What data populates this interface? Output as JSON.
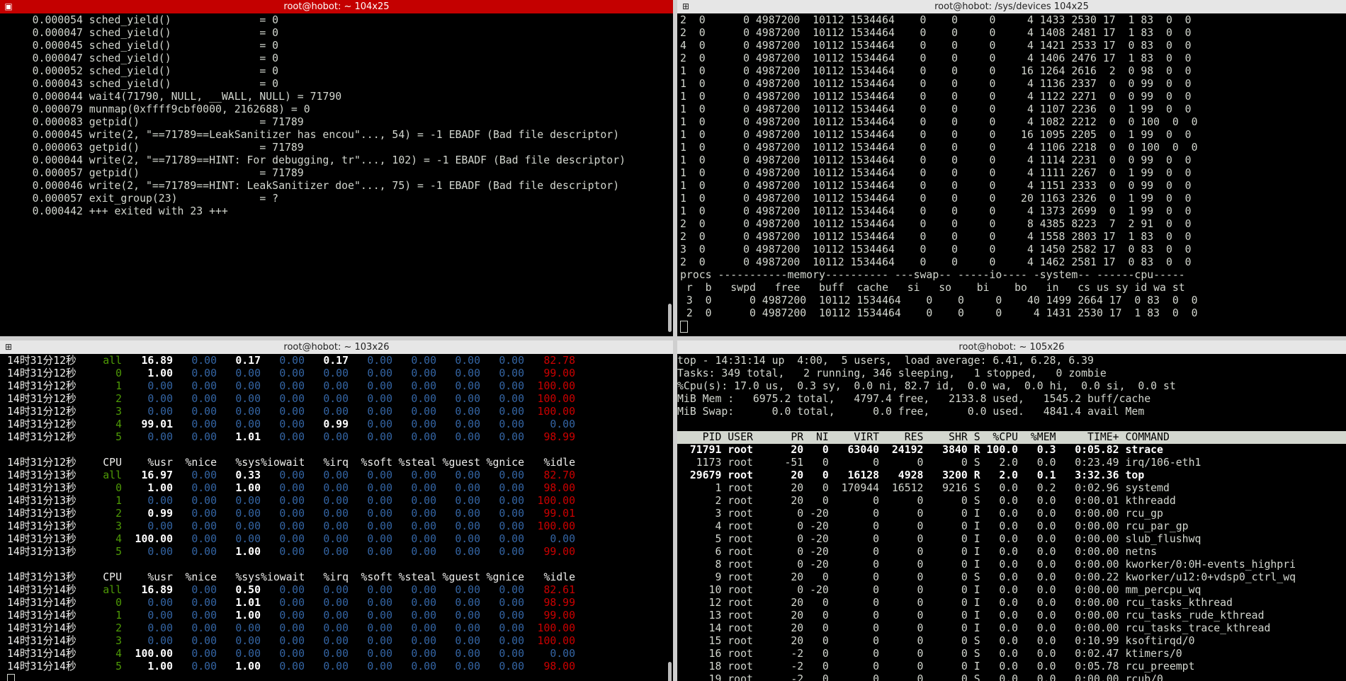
{
  "panes": {
    "tl": {
      "title": "root@hobot: ~ 104x25",
      "lines": [
        "    0.000054 sched_yield()              = 0",
        "    0.000047 sched_yield()              = 0",
        "    0.000045 sched_yield()              = 0",
        "    0.000047 sched_yield()              = 0",
        "    0.000052 sched_yield()              = 0",
        "    0.000043 sched_yield()              = 0",
        "    0.000044 wait4(71790, NULL, __WALL, NULL) = 71790",
        "    0.000079 munmap(0xffff9cbf0000, 2162688) = 0",
        "    0.000083 getpid()                   = 71789",
        "    0.000045 write(2, \"==71789==LeakSanitizer has encou\"..., 54) = -1 EBADF (Bad file descriptor)",
        "    0.000063 getpid()                   = 71789",
        "    0.000044 write(2, \"==71789==HINT: For debugging, tr\"..., 102) = -1 EBADF (Bad file descriptor)",
        "    0.000057 getpid()                   = 71789",
        "    0.000046 write(2, \"==71789==HINT: LeakSanitizer doe\"..., 75) = -1 EBADF (Bad file descriptor)",
        "    0.000057 exit_group(23)             = ?",
        "    0.000442 +++ exited with 23 +++"
      ]
    },
    "tr": {
      "title": "root@hobot: /sys/devices 104x25",
      "lines": [
        "2  0      0 4987200  10112 1534464    0    0     0     4 1433 2530 17  1 83  0  0",
        "2  0      0 4987200  10112 1534464    0    0     0     4 1408 2481 17  1 83  0  0",
        "4  0      0 4987200  10112 1534464    0    0     0     4 1421 2533 17  0 83  0  0",
        "2  0      0 4987200  10112 1534464    0    0     0     4 1406 2476 17  1 83  0  0",
        "1  0      0 4987200  10112 1534464    0    0     0    16 1264 2616  2  0 98  0  0",
        "1  0      0 4987200  10112 1534464    0    0     0     4 1136 2337  0  0 99  0  0",
        "1  0      0 4987200  10112 1534464    0    0     0     4 1122 2271  0  0 99  0  0",
        "1  0      0 4987200  10112 1534464    0    0     0     4 1107 2236  0  1 99  0  0",
        "1  0      0 4987200  10112 1534464    0    0     0     4 1082 2212  0  0 100  0  0",
        "1  0      0 4987200  10112 1534464    0    0     0    16 1095 2205  0  1 99  0  0",
        "1  0      0 4987200  10112 1534464    0    0     0     4 1106 2218  0  0 100  0  0",
        "1  0      0 4987200  10112 1534464    0    0     0     4 1114 2231  0  0 99  0  0",
        "1  0      0 4987200  10112 1534464    0    0     0     4 1111 2267  0  1 99  0  0",
        "1  0      0 4987200  10112 1534464    0    0     0     4 1151 2333  0  0 99  0  0",
        "1  0      0 4987200  10112 1534464    0    0     0    20 1163 2326  0  1 99  0  0",
        "1  0      0 4987200  10112 1534464    0    0     0     4 1373 2699  0  1 99  0  0",
        "2  0      0 4987200  10112 1534464    0    0     0     8 4385 8223  7  2 91  0  0",
        "2  0      0 4987200  10112 1534464    0    0     0     4 1558 2803 17  1 83  0  0",
        "3  0      0 4987200  10112 1534464    0    0     0     4 1450 2582 17  0 83  0  0",
        "2  0      0 4987200  10112 1534464    0    0     0     4 1462 2581 17  0 83  0  0",
        "procs -----------memory---------- ---swap-- -----io---- -system-- ------cpu-----",
        " r  b   swpd   free   buff  cache   si   so    bi    bo   in   cs us sy id wa st",
        " 3  0      0 4987200  10112 1534464    0    0     0    40 1499 2664 17  0 83  0  0",
        " 2  0      0 4987200  10112 1534464    0    0     0     4 1431 2530 17  1 83  0  0"
      ]
    },
    "bl": {
      "title": "root@hobot: ~ 103x26",
      "blocks": [
        {
          "rows": [
            [
              "14时31分12秒",
              "all",
              "16.89",
              "0.00",
              "0.17",
              "0.00",
              "0.17",
              "0.00",
              "0.00",
              "0.00",
              "0.00",
              "82.78"
            ],
            [
              "14时31分12秒",
              "0",
              "1.00",
              "0.00",
              "0.00",
              "0.00",
              "0.00",
              "0.00",
              "0.00",
              "0.00",
              "0.00",
              "99.00"
            ],
            [
              "14时31分12秒",
              "1",
              "0.00",
              "0.00",
              "0.00",
              "0.00",
              "0.00",
              "0.00",
              "0.00",
              "0.00",
              "0.00",
              "100.00"
            ],
            [
              "14时31分12秒",
              "2",
              "0.00",
              "0.00",
              "0.00",
              "0.00",
              "0.00",
              "0.00",
              "0.00",
              "0.00",
              "0.00",
              "100.00"
            ],
            [
              "14时31分12秒",
              "3",
              "0.00",
              "0.00",
              "0.00",
              "0.00",
              "0.00",
              "0.00",
              "0.00",
              "0.00",
              "0.00",
              "100.00"
            ],
            [
              "14时31分12秒",
              "4",
              "99.01",
              "0.00",
              "0.00",
              "0.00",
              "0.99",
              "0.00",
              "0.00",
              "0.00",
              "0.00",
              "0.00"
            ],
            [
              "14时31分12秒",
              "5",
              "0.00",
              "0.00",
              "1.01",
              "0.00",
              "0.00",
              "0.00",
              "0.00",
              "0.00",
              "0.00",
              "98.99"
            ]
          ]
        },
        {
          "header": [
            "14时31分12秒",
            "CPU",
            "%usr",
            "%nice",
            "%sys",
            "%iowait",
            "%irq",
            "%soft",
            "%steal",
            "%guest",
            "%gnice",
            "%idle"
          ],
          "rows": [
            [
              "14时31分13秒",
              "all",
              "16.97",
              "0.00",
              "0.33",
              "0.00",
              "0.00",
              "0.00",
              "0.00",
              "0.00",
              "0.00",
              "82.70"
            ],
            [
              "14时31分13秒",
              "0",
              "1.00",
              "0.00",
              "1.00",
              "0.00",
              "0.00",
              "0.00",
              "0.00",
              "0.00",
              "0.00",
              "98.00"
            ],
            [
              "14时31分13秒",
              "1",
              "0.00",
              "0.00",
              "0.00",
              "0.00",
              "0.00",
              "0.00",
              "0.00",
              "0.00",
              "0.00",
              "100.00"
            ],
            [
              "14时31分13秒",
              "2",
              "0.99",
              "0.00",
              "0.00",
              "0.00",
              "0.00",
              "0.00",
              "0.00",
              "0.00",
              "0.00",
              "99.01"
            ],
            [
              "14时31分13秒",
              "3",
              "0.00",
              "0.00",
              "0.00",
              "0.00",
              "0.00",
              "0.00",
              "0.00",
              "0.00",
              "0.00",
              "100.00"
            ],
            [
              "14时31分13秒",
              "4",
              "100.00",
              "0.00",
              "0.00",
              "0.00",
              "0.00",
              "0.00",
              "0.00",
              "0.00",
              "0.00",
              "0.00"
            ],
            [
              "14时31分13秒",
              "5",
              "0.00",
              "0.00",
              "1.00",
              "0.00",
              "0.00",
              "0.00",
              "0.00",
              "0.00",
              "0.00",
              "99.00"
            ]
          ]
        },
        {
          "header": [
            "14时31分13秒",
            "CPU",
            "%usr",
            "%nice",
            "%sys",
            "%iowait",
            "%irq",
            "%soft",
            "%steal",
            "%guest",
            "%gnice",
            "%idle"
          ],
          "rows": [
            [
              "14时31分14秒",
              "all",
              "16.89",
              "0.00",
              "0.50",
              "0.00",
              "0.00",
              "0.00",
              "0.00",
              "0.00",
              "0.00",
              "82.61"
            ],
            [
              "14时31分14秒",
              "0",
              "0.00",
              "0.00",
              "1.01",
              "0.00",
              "0.00",
              "0.00",
              "0.00",
              "0.00",
              "0.00",
              "98.99"
            ],
            [
              "14时31分14秒",
              "1",
              "0.00",
              "0.00",
              "1.00",
              "0.00",
              "0.00",
              "0.00",
              "0.00",
              "0.00",
              "0.00",
              "99.00"
            ],
            [
              "14时31分14秒",
              "2",
              "0.00",
              "0.00",
              "0.00",
              "0.00",
              "0.00",
              "0.00",
              "0.00",
              "0.00",
              "0.00",
              "100.00"
            ],
            [
              "14时31分14秒",
              "3",
              "0.00",
              "0.00",
              "0.00",
              "0.00",
              "0.00",
              "0.00",
              "0.00",
              "0.00",
              "0.00",
              "100.00"
            ],
            [
              "14时31分14秒",
              "4",
              "100.00",
              "0.00",
              "0.00",
              "0.00",
              "0.00",
              "0.00",
              "0.00",
              "0.00",
              "0.00",
              "0.00"
            ],
            [
              "14时31分14秒",
              "5",
              "1.00",
              "0.00",
              "1.00",
              "0.00",
              "0.00",
              "0.00",
              "0.00",
              "0.00",
              "0.00",
              "98.00"
            ]
          ]
        }
      ]
    },
    "br": {
      "title": "root@hobot: ~ 105x26",
      "summary": [
        "top - 14:31:14 up  4:00,  5 users,  load average: 6.41, 6.28, 6.39",
        "Tasks: 349 total,   2 running, 346 sleeping,   1 stopped,   0 zombie",
        "%Cpu(s): 17.0 us,  0.3 sy,  0.0 ni, 82.7 id,  0.0 wa,  0.0 hi,  0.0 si,  0.0 st",
        "MiB Mem :   6975.2 total,   4797.4 free,   2133.8 used,   1545.2 buff/cache",
        "MiB Swap:      0.0 total,      0.0 free,      0.0 used.   4841.4 avail Mem"
      ],
      "header": "    PID USER      PR  NI    VIRT    RES    SHR S  %CPU  %MEM     TIME+ COMMAND",
      "procs": [
        {
          "t": "  71791 root      20   0   63040  24192   3840 R 100.0   0.3   0:05.82 strace",
          "bold": true
        },
        {
          "t": "   1173 root     -51   0       0      0      0 S   2.0   0.0   0:23.49 irq/106-eth1",
          "bold": false
        },
        {
          "t": "  29679 root      20   0   16128   4928   3200 R   2.0   0.1   3:32.36 top",
          "bold": true
        },
        {
          "t": "      1 root      20   0  170944  16512   9216 S   0.0   0.2   0:02.96 systemd",
          "bold": false
        },
        {
          "t": "      2 root      20   0       0      0      0 S   0.0   0.0   0:00.01 kthreadd",
          "bold": false
        },
        {
          "t": "      3 root       0 -20       0      0      0 I   0.0   0.0   0:00.00 rcu_gp",
          "bold": false
        },
        {
          "t": "      4 root       0 -20       0      0      0 I   0.0   0.0   0:00.00 rcu_par_gp",
          "bold": false
        },
        {
          "t": "      5 root       0 -20       0      0      0 I   0.0   0.0   0:00.00 slub_flushwq",
          "bold": false
        },
        {
          "t": "      6 root       0 -20       0      0      0 I   0.0   0.0   0:00.00 netns",
          "bold": false
        },
        {
          "t": "      8 root       0 -20       0      0      0 I   0.0   0.0   0:00.00 kworker/0:0H-events_highpri",
          "bold": false
        },
        {
          "t": "      9 root      20   0       0      0      0 S   0.0   0.0   0:00.22 kworker/u12:0+vdsp0_ctrl_wq",
          "bold": false
        },
        {
          "t": "     10 root       0 -20       0      0      0 I   0.0   0.0   0:00.00 mm_percpu_wq",
          "bold": false
        },
        {
          "t": "     12 root      20   0       0      0      0 I   0.0   0.0   0:00.00 rcu_tasks_kthread",
          "bold": false
        },
        {
          "t": "     13 root      20   0       0      0      0 I   0.0   0.0   0:00.00 rcu_tasks_rude_kthread",
          "bold": false
        },
        {
          "t": "     14 root      20   0       0      0      0 I   0.0   0.0   0:00.00 rcu_tasks_trace_kthread",
          "bold": false
        },
        {
          "t": "     15 root      20   0       0      0      0 S   0.0   0.0   0:10.99 ksoftirqd/0",
          "bold": false
        },
        {
          "t": "     16 root      -2   0       0      0      0 S   0.0   0.0   0:02.47 ktimers/0",
          "bold": false
        },
        {
          "t": "     18 root      -2   0       0      0      0 I   0.0   0.0   0:05.78 rcu_preempt",
          "bold": false
        },
        {
          "t": "     19 root      -2   0       0      0      0 S   0.0   0.0   0:00.00 rcub/0",
          "bold": false
        }
      ]
    }
  }
}
